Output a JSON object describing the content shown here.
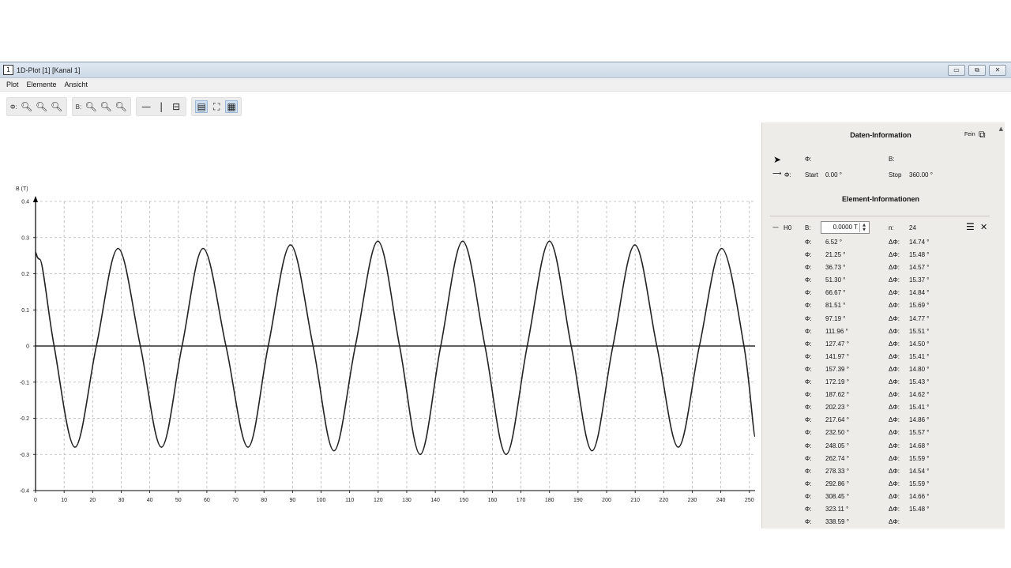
{
  "window": {
    "title": "1D-Plot [1] [Kanal 1]",
    "icon_glyph": "1",
    "controls": {
      "minimize": "▭",
      "maximize": "⧉",
      "close": "✕"
    }
  },
  "menu": [
    "Plot",
    "Elemente",
    "Ansicht"
  ],
  "toolbar": {
    "phi_label": "Φ:",
    "b_label": "B:"
  },
  "chart_data": {
    "type": "line",
    "ylabel": "B (T)",
    "xlim": [
      0,
      252
    ],
    "ylim": [
      -0.4,
      0.4
    ],
    "x_ticks": [
      0,
      10,
      20,
      30,
      40,
      50,
      60,
      70,
      80,
      90,
      100,
      110,
      120,
      130,
      140,
      150,
      160,
      170,
      180,
      190,
      200,
      210,
      220,
      230,
      240,
      250
    ],
    "y_ticks": [
      0.4,
      0.3,
      0.2,
      0.1,
      0,
      -0.1,
      -0.2,
      -0.3,
      -0.4
    ],
    "y_tick_labels": [
      "0.4",
      "0.3",
      "0.2",
      "0.1",
      "0",
      "-0.1",
      "-0.2",
      "-0.3",
      "-0.4"
    ],
    "grid": true,
    "series": [
      {
        "x": [
          0,
          1.5,
          6.5,
          13.8,
          21.3,
          28.9,
          36.7,
          44.1,
          51.3,
          58.7,
          66.7,
          74.4,
          81.5,
          89.3,
          97.2,
          104.5,
          112.0,
          119.9,
          127.5,
          134.7,
          141.9,
          149.6,
          157.4,
          164.8,
          172.2,
          180.0,
          187.6,
          194.9,
          202.2,
          209.9,
          217.6,
          225.1,
          232.5,
          240.3,
          248.1,
          252
        ],
        "y": [
          0.26,
          0.24,
          0,
          -0.28,
          0,
          0.27,
          0,
          -0.28,
          0,
          0.27,
          0,
          -0.28,
          0,
          0.28,
          0,
          -0.29,
          0,
          0.29,
          0,
          -0.3,
          0,
          0.29,
          0,
          -0.3,
          0,
          0.29,
          0,
          -0.29,
          0,
          0.28,
          0,
          -0.28,
          0,
          0.27,
          0,
          -0.25
        ]
      }
    ]
  },
  "panel": {
    "data_info_title": "Daten-Information",
    "fein_label": "Fein",
    "phi_label": "Φ:",
    "b_label": "B:",
    "start_label": "Start",
    "start_value": "0.00 °",
    "stop_label": "Stop",
    "stop_value": "360.00 °",
    "element_info_title": "Element-Informationen",
    "element_name": "H0",
    "element_b_label": "B:",
    "b_value": "0.0000 T",
    "n_label": "n:",
    "n_value": "24",
    "phi_row_label": "Φ:",
    "dphi_row_label": "ΔΦ:",
    "zero_crossings": [
      {
        "phi": "6.52 °",
        "dphi": "14.74 °"
      },
      {
        "phi": "21.25 °",
        "dphi": "15.48 °"
      },
      {
        "phi": "36.73 °",
        "dphi": "14.57 °"
      },
      {
        "phi": "51.30 °",
        "dphi": "15.37 °"
      },
      {
        "phi": "66.67 °",
        "dphi": "14.84 °"
      },
      {
        "phi": "81.51 °",
        "dphi": "15.69 °"
      },
      {
        "phi": "97.19 °",
        "dphi": "14.77 °"
      },
      {
        "phi": "111.96 °",
        "dphi": "15.51 °"
      },
      {
        "phi": "127.47 °",
        "dphi": "14.50 °"
      },
      {
        "phi": "141.97 °",
        "dphi": "15.41 °"
      },
      {
        "phi": "157.39 °",
        "dphi": "14.80 °"
      },
      {
        "phi": "172.19 °",
        "dphi": "15.43 °"
      },
      {
        "phi": "187.62 °",
        "dphi": "14.62 °"
      },
      {
        "phi": "202.23 °",
        "dphi": "15.41 °"
      },
      {
        "phi": "217.64 °",
        "dphi": "14.86 °"
      },
      {
        "phi": "232.50 °",
        "dphi": "15.57 °"
      },
      {
        "phi": "248.05 °",
        "dphi": "14.68 °"
      },
      {
        "phi": "262.74 °",
        "dphi": "15.59 °"
      },
      {
        "phi": "278.33 °",
        "dphi": "14.54 °"
      },
      {
        "phi": "292.86 °",
        "dphi": "15.59 °"
      },
      {
        "phi": "308.45 °",
        "dphi": "14.66 °"
      },
      {
        "phi": "323.11 °",
        "dphi": "15.48 °"
      },
      {
        "phi": "338.59 °",
        "dphi": ""
      }
    ]
  }
}
